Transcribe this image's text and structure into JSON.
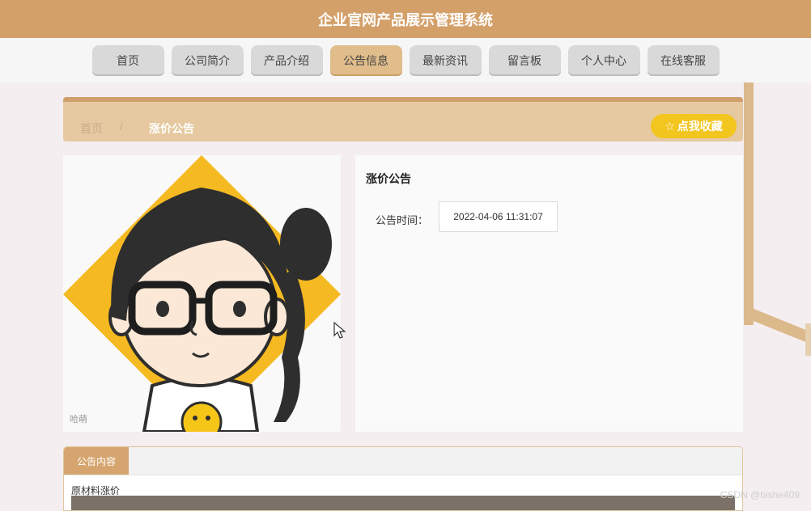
{
  "app": {
    "title": "企业官网产品展示管理系统"
  },
  "nav": {
    "items": [
      "首页",
      "公司简介",
      "产品介绍",
      "公告信息",
      "最新资讯",
      "留言板",
      "个人中心",
      "在线客服"
    ],
    "active_index": 3
  },
  "breadcrumb": {
    "home": "首页",
    "separator": "/",
    "current": "涨价公告"
  },
  "favorite_button": {
    "icon": "star-outline-icon",
    "label": "点我收藏"
  },
  "image_panel": {
    "caption": "哈萌"
  },
  "detail": {
    "title": "涨价公告",
    "time_label": "公告时间：",
    "time_value": "2022-04-06 11:31:07"
  },
  "content": {
    "tab_label": "公告内容",
    "text": "原材料涨价"
  },
  "watermark": "CSDN @bishe409",
  "colors": {
    "header": "#d4a06a",
    "accent": "#e0bd8a",
    "button": "#f2c51f"
  }
}
